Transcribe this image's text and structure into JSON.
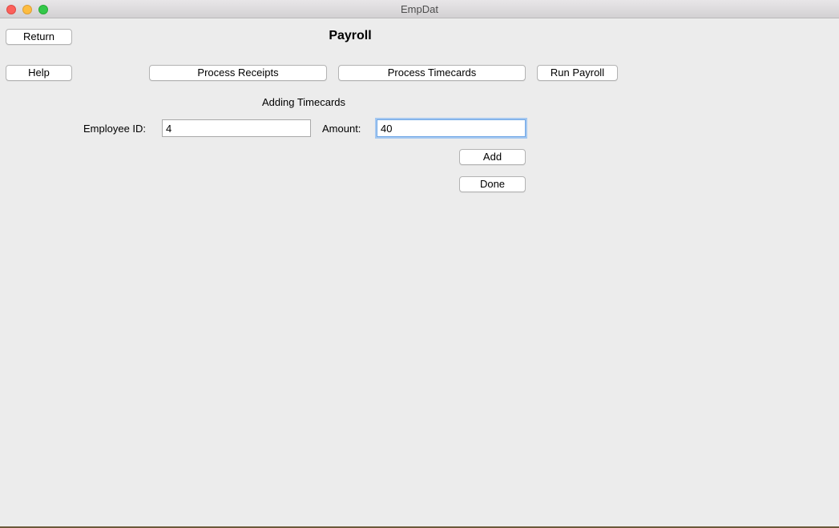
{
  "window": {
    "title": "EmpDat"
  },
  "header": {
    "title": "Payroll",
    "return_label": "Return"
  },
  "toolbar": {
    "help_label": "Help",
    "process_receipts_label": "Process Receipts",
    "process_timecards_label": "Process Timecards",
    "run_payroll_label": "Run Payroll"
  },
  "form": {
    "section_title": "Adding Timecards",
    "employee_id_label": "Employee ID:",
    "employee_id_value": "4",
    "amount_label": "Amount:",
    "amount_value": "40",
    "add_label": "Add",
    "done_label": "Done"
  }
}
